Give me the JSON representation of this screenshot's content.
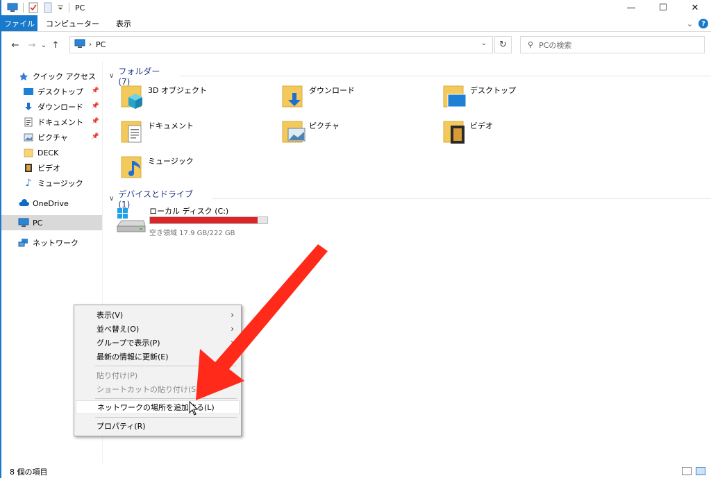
{
  "window": {
    "title": "PC",
    "controls": [
      "—",
      "☐",
      "✕"
    ]
  },
  "ribbon": {
    "tabs": [
      {
        "label": "ファイル"
      },
      {
        "label": "コンピューター"
      },
      {
        "label": "表示"
      }
    ],
    "expand": "⌄"
  },
  "nav": {
    "back": "←",
    "forward": "→",
    "recent": "⌄",
    "up": "↑",
    "address": "PC",
    "search_placeholder": "PCの検索"
  },
  "sidebar": {
    "items": [
      {
        "label": "クイック アクセス",
        "icon": "star-icon"
      },
      {
        "label": "デスクトップ",
        "icon": "desktop-icon",
        "pinned": true
      },
      {
        "label": "ダウンロード",
        "icon": "download-icon",
        "pinned": true
      },
      {
        "label": "ドキュメント",
        "icon": "document-icon",
        "pinned": true
      },
      {
        "label": "ピクチャ",
        "icon": "picture-icon",
        "pinned": true
      },
      {
        "label": "DECK",
        "icon": "folder-icon"
      },
      {
        "label": "ビデオ",
        "icon": "video-icon"
      },
      {
        "label": "ミュージック",
        "icon": "music-icon"
      },
      {
        "label": "OneDrive",
        "icon": "cloud-icon"
      },
      {
        "label": "PC",
        "icon": "pc-icon",
        "selected": true
      },
      {
        "label": "ネットワーク",
        "icon": "network-icon"
      }
    ]
  },
  "content": {
    "folders_header": "フォルダー (7)",
    "folders": [
      {
        "label": "3D オブジェクト",
        "icon": "3d-objects-icon"
      },
      {
        "label": "ダウンロード",
        "icon": "downloads-folder-icon"
      },
      {
        "label": "デスクトップ",
        "icon": "desktop-folder-icon"
      },
      {
        "label": "ドキュメント",
        "icon": "documents-folder-icon"
      },
      {
        "label": "ピクチャ",
        "icon": "pictures-folder-icon"
      },
      {
        "label": "ビデオ",
        "icon": "videos-folder-icon"
      },
      {
        "label": "ミュージック",
        "icon": "music-folder-icon"
      }
    ],
    "drives_header": "デバイスとドライブ (1)",
    "drive": {
      "label": "ローカル ディスク (C:)",
      "free_text": "空き領域 17.9 GB/222 GB",
      "used_fraction": 0.919,
      "bar_color": "#da2626"
    }
  },
  "status": {
    "count": "8 個の項目"
  },
  "context_menu": {
    "items": [
      {
        "label": "表示(V)",
        "submenu": true
      },
      {
        "label": "並べ替え(O)",
        "submenu": true
      },
      {
        "label": "グループで表示(P)",
        "submenu": true
      },
      {
        "label": "最新の情報に更新(E)"
      },
      {
        "label": "貼り付け(P)",
        "disabled": true
      },
      {
        "label": "ショートカットの貼り付け(S)",
        "disabled": true
      },
      {
        "label": "ネットワークの場所を追加する(L)",
        "highlighted": true
      },
      {
        "label": "プロパティ(R)"
      }
    ],
    "submenu_arrow": "›"
  },
  "annotation": {
    "arrow_color": "#ff2a1a"
  }
}
